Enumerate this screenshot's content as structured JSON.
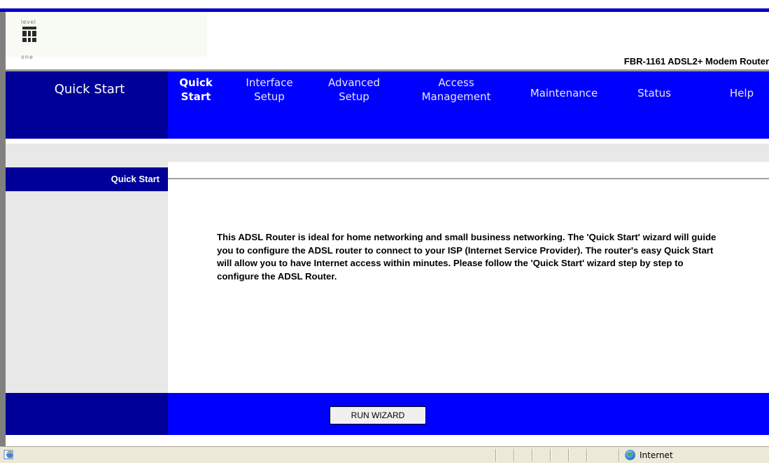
{
  "logo": {
    "top_text": "level",
    "bottom_text": "one"
  },
  "header": {
    "product_name": "FBR-1161 ADSL2+ Modem Router"
  },
  "nav": {
    "current_section": "Quick Start",
    "items": [
      {
        "label": "Quick Start",
        "active": true
      },
      {
        "label": "Interface Setup"
      },
      {
        "label": "Advanced Setup"
      },
      {
        "label": "Access Management"
      },
      {
        "label": "Maintenance"
      },
      {
        "label": "Status"
      },
      {
        "label": "Help"
      }
    ]
  },
  "section": {
    "title": "Quick Start"
  },
  "content": {
    "description": "This ADSL Router is ideal for home networking and small business networking. The 'Quick Start' wizard will guide you to configure the ADSL router to connect to your ISP (Internet Service Provider). The router's easy Quick Start will allow you to have Internet access within minutes. Please follow the 'Quick Start' wizard step by step to configure the ADSL Router."
  },
  "actions": {
    "run_wizard": "RUN WIZARD"
  },
  "status_bar": {
    "zone": "Internet"
  },
  "colors": {
    "nav_blue": "#0000ff",
    "nav_dark_blue": "#000099",
    "panel_gray": "#e8e8e8"
  }
}
